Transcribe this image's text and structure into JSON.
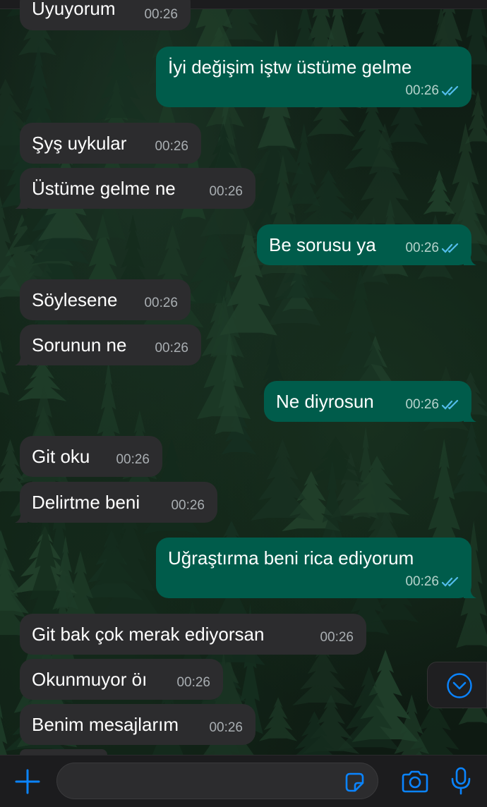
{
  "colors": {
    "incoming_bubble": "#2c2c2e",
    "outgoing_bubble": "#005c4b",
    "read_ticks": "#53bdeb",
    "accent": "#0a84ff"
  },
  "messages": [
    {
      "dir": "in",
      "text": "Uyuyorum",
      "time": "00:26"
    },
    {
      "dir": "out",
      "text": "İyi değişim iştw üstüme gelme",
      "time": "00:26"
    },
    {
      "dir": "in",
      "text": "Şyş uykular",
      "time": "00:26"
    },
    {
      "dir": "in",
      "text": "Üstüme gelme ne",
      "time": "00:26"
    },
    {
      "dir": "out",
      "text": "Be sorusu ya",
      "time": "00:26"
    },
    {
      "dir": "in",
      "text": "Söylesene",
      "time": "00:26"
    },
    {
      "dir": "in",
      "text": "Sorunun ne",
      "time": "00:26"
    },
    {
      "dir": "out",
      "text": "Ne diyrosun",
      "time": "00:26"
    },
    {
      "dir": "in",
      "text": "Git oku",
      "time": "00:26"
    },
    {
      "dir": "in",
      "text": "Delirtme beni",
      "time": "00:26"
    },
    {
      "dir": "out",
      "text": "Uğraştırma beni rica ediyorum",
      "time": "00:26"
    },
    {
      "dir": "in",
      "text": "Git bak çok merak ediyorsan",
      "time": "00:26"
    },
    {
      "dir": "in",
      "text": "Okunmuyor öı",
      "time": "00:26"
    },
    {
      "dir": "in",
      "text": "Benim mesajlarım",
      "time": "00:26"
    }
  ],
  "composer": {
    "input_value": "",
    "icons": [
      "plus-icon",
      "sticker-icon",
      "camera-icon",
      "microphone-icon"
    ]
  },
  "scroll_down_icon": "chevron-down-circle-icon"
}
